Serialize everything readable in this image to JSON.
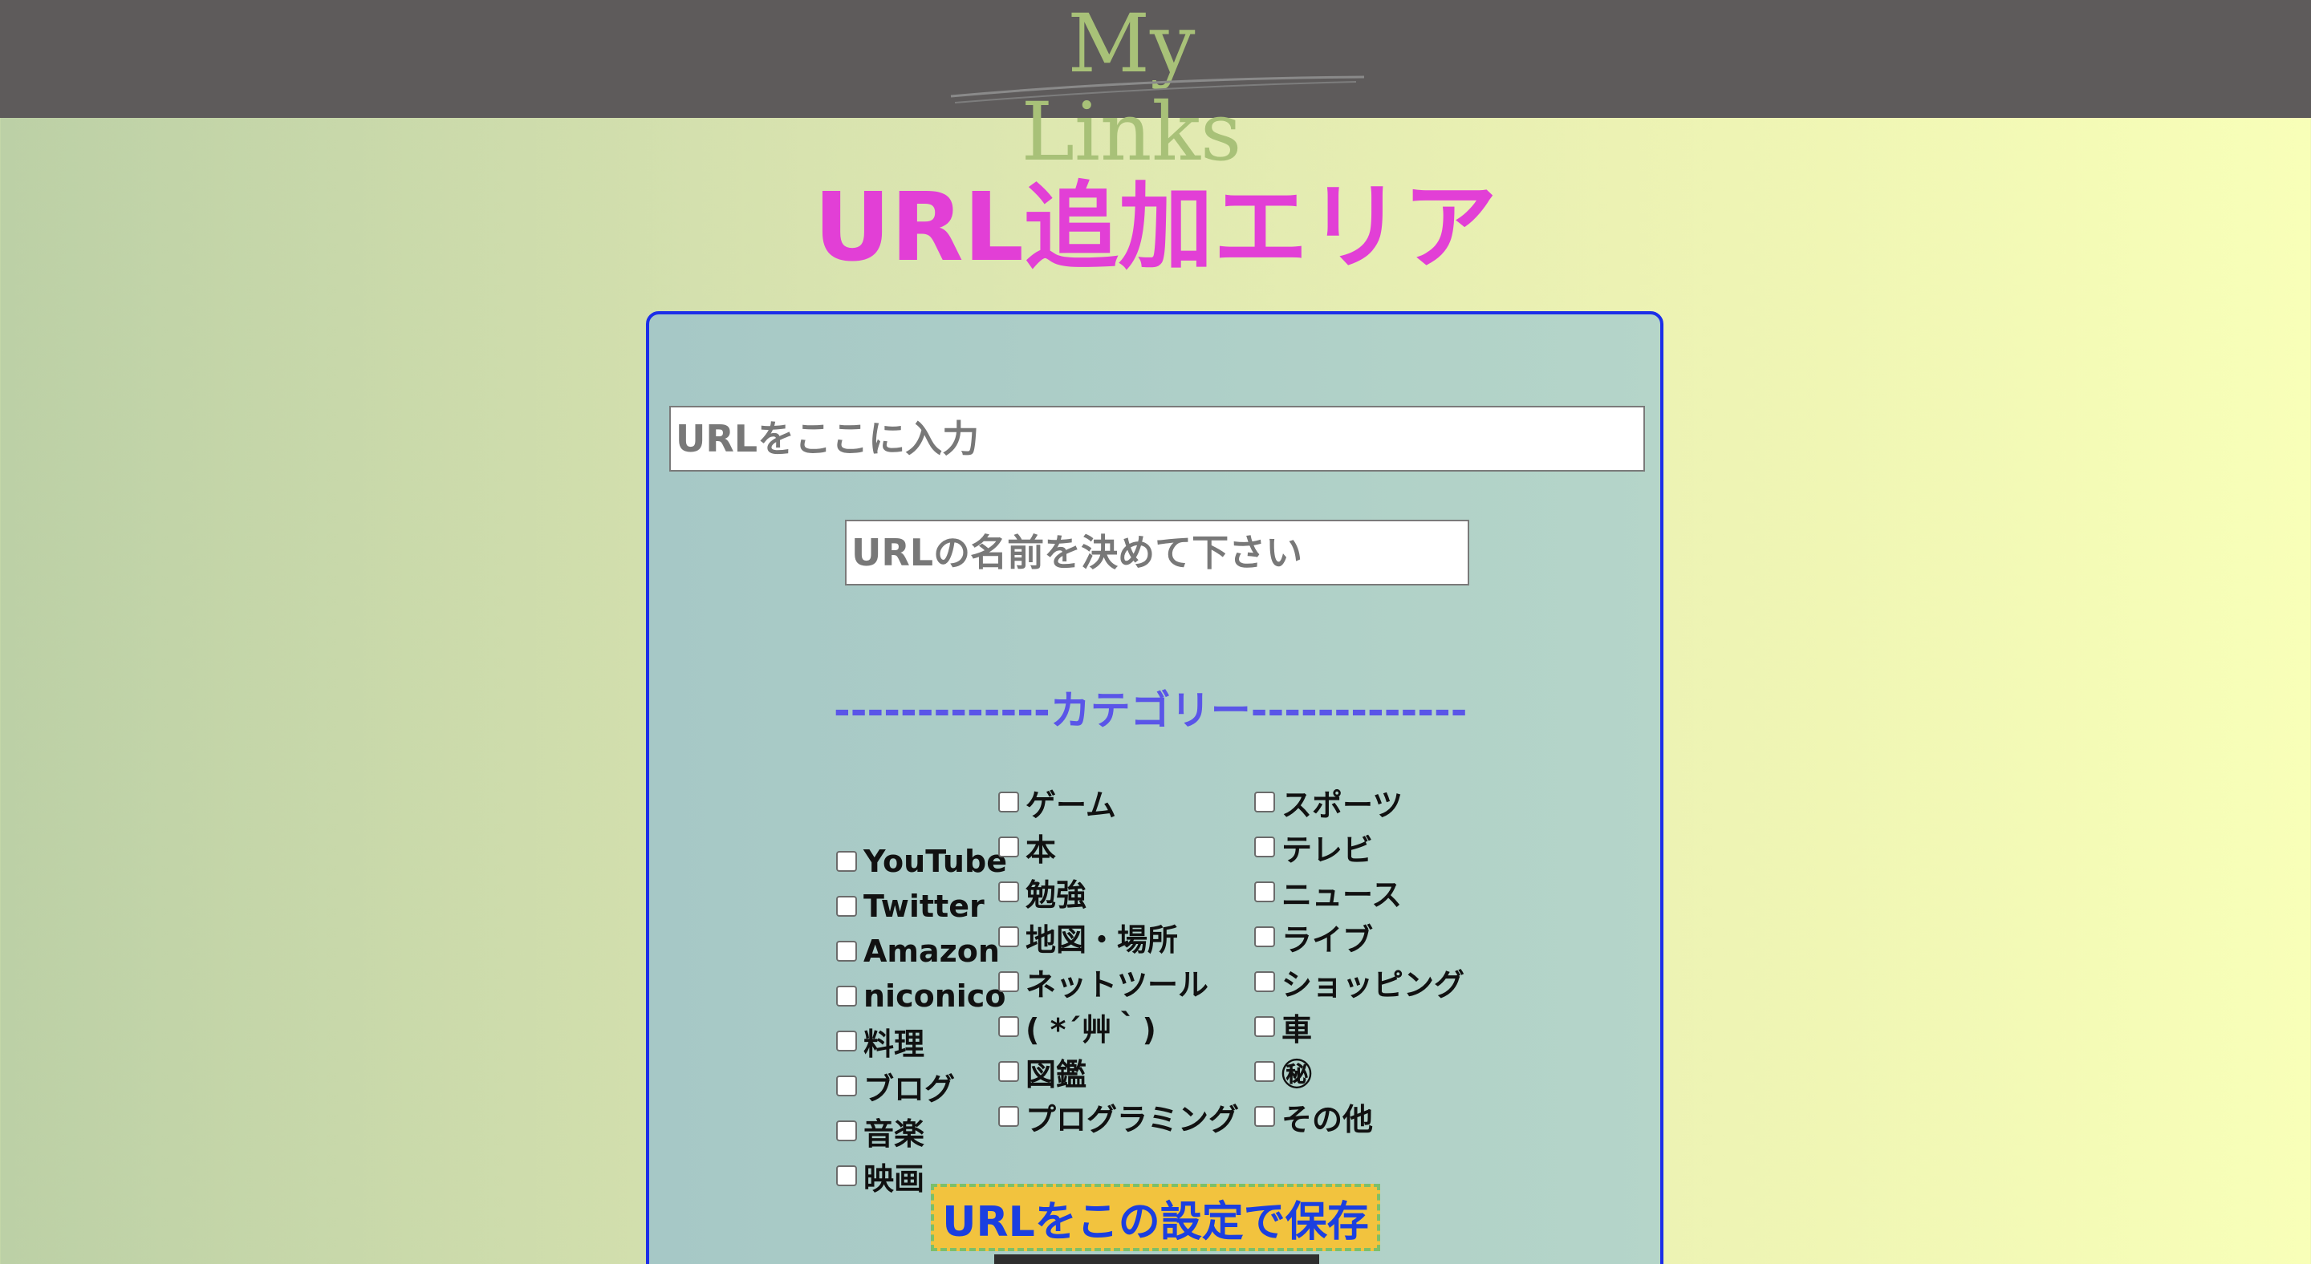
{
  "header": {
    "logo_text": "My Links"
  },
  "page_title": "URL追加エリア",
  "form": {
    "url_placeholder": "URLをここに入力",
    "name_placeholder": "URLの名前を決めて下さい",
    "category_heading": "-------------カテゴリー-------------",
    "columns": [
      [
        "YouTube",
        "Twitter",
        "Amazon",
        "niconico",
        "料理",
        "ブログ",
        "音楽",
        "映画"
      ],
      [
        "ゲーム",
        "本",
        "勉強",
        "地図・場所",
        "ネットツール",
        "( *´艸｀)",
        "図鑑",
        "プログラミング"
      ],
      [
        "スポーツ",
        "テレビ",
        "ニュース",
        "ライブ",
        "ショッピング",
        "車",
        "㊙",
        "その他"
      ]
    ],
    "save_label": "URLをこの設定で保存"
  },
  "colors": {
    "header_bg": "#5e5b5b",
    "logo": "#a8c178",
    "title": "#e23fd6",
    "panel_border": "#1c2ee8",
    "category_heading": "#5a55e8",
    "save_bg": "#f2c33e",
    "save_text": "#1b3fe0"
  }
}
